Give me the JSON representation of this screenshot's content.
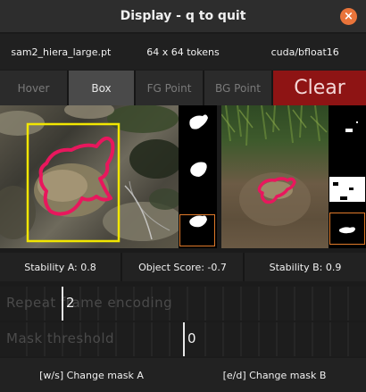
{
  "window": {
    "title": "Display - q to quit",
    "close_glyph": "×"
  },
  "info": {
    "model": "sam2_hiera_large.pt",
    "tokens": "64 x 64 tokens",
    "device": "cuda/bfloat16"
  },
  "buttons": {
    "hover": "Hover",
    "box": "Box",
    "fg_point": "FG Point",
    "bg_point": "BG Point",
    "clear": "Clear",
    "selected": "Box"
  },
  "stats": {
    "stability_a": "Stability A: 0.8",
    "object_score": "Object Score: -0.7",
    "stability_b": "Stability B: 0.9"
  },
  "sliders": {
    "repeat": {
      "label": "Repeat frame encoding",
      "value": "2"
    },
    "threshold": {
      "label": "Mask threshold",
      "value": "0"
    }
  },
  "footer": {
    "left": "[w/s] Change mask A",
    "right": "[e/d] Change mask B"
  },
  "colors": {
    "clear_button": "#8e1414",
    "box_outline": "#f2e600",
    "mask_outline": "#e8175d",
    "close_button": "#e9743a",
    "selected_thumb": "#e07a2a"
  }
}
